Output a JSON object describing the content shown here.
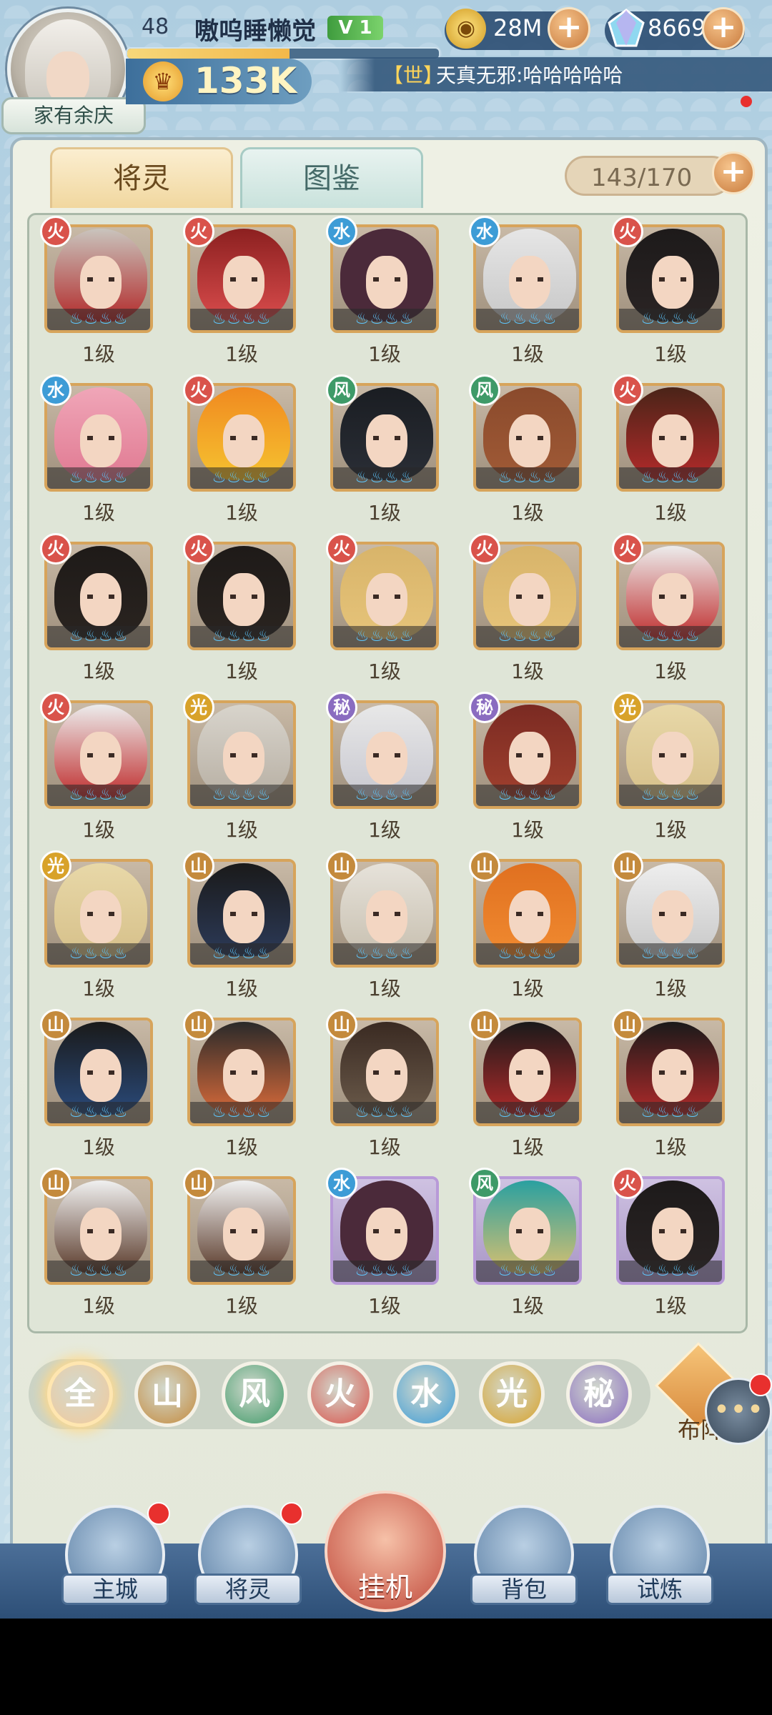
{
  "header": {
    "avatar_icon": "hero-avatar-icon",
    "nickname_badge": "家有余庆",
    "level": "48",
    "player_name": "嗷呜睡懒觉",
    "vip": "V 1",
    "exp_fraction": 0.52,
    "power_value": "133K",
    "gold_value": "28M",
    "gem_value": "8669",
    "plus": "+",
    "chat_channel": "【世】",
    "chat_text": "天真无邪:哈哈哈哈哈"
  },
  "tabs": {
    "spirits": "将灵",
    "codex": "图鉴"
  },
  "capacity": "143/170",
  "grid": {
    "level_label": "1级",
    "stars": "♨♨♨♨",
    "element_colors": {
      "fire": "#d9534b",
      "water": "#3d9cd6",
      "wind": "#3e9a68",
      "light": "#d8a22a",
      "arcane": "#8a6cc0",
      "earth": "#c48a3c"
    },
    "element_glyphs": {
      "fire": "火",
      "water": "水",
      "wind": "风",
      "light": "光",
      "arcane": "秘",
      "earth": "山"
    },
    "cards": [
      {
        "element": "fire",
        "hair": "#c9c4bd",
        "accent": "#b22a2a",
        "rarity": "gold"
      },
      {
        "element": "fire",
        "hair": "#8c2020",
        "accent": "#d94c4c",
        "rarity": "gold"
      },
      {
        "element": "water",
        "hair": "#4b2a3a",
        "accent": "#4b2a3a",
        "rarity": "gold"
      },
      {
        "element": "water",
        "hair": "#e6e6e6",
        "accent": "#c8c8c8",
        "rarity": "gold"
      },
      {
        "element": "fire",
        "hair": "#1d1a1a",
        "accent": "#2a2424",
        "rarity": "gold"
      },
      {
        "element": "water",
        "hair": "#f0a6b8",
        "accent": "#e07a92",
        "rarity": "gold"
      },
      {
        "element": "fire",
        "hair": "#f08a20",
        "accent": "#f6c230",
        "rarity": "gold"
      },
      {
        "element": "wind",
        "hair": "#1a1d22",
        "accent": "#2a2e36",
        "rarity": "gold"
      },
      {
        "element": "wind",
        "hair": "#8a4a2c",
        "accent": "#a05a36",
        "rarity": "gold"
      },
      {
        "element": "fire",
        "hair": "#4a2418",
        "accent": "#b32a2a",
        "rarity": "gold"
      },
      {
        "element": "fire",
        "hair": "#1e1a18",
        "accent": "#2a2420",
        "rarity": "gold"
      },
      {
        "element": "fire",
        "hair": "#1e1a18",
        "accent": "#2a2420",
        "rarity": "gold"
      },
      {
        "element": "fire",
        "hair": "#d8b46a",
        "accent": "#e6c47a",
        "rarity": "gold"
      },
      {
        "element": "fire",
        "hair": "#d8b46a",
        "accent": "#e6c47a",
        "rarity": "gold"
      },
      {
        "element": "fire",
        "hair": "#ececec",
        "accent": "#c03030",
        "rarity": "gold"
      },
      {
        "element": "fire",
        "hair": "#ececec",
        "accent": "#c03030",
        "rarity": "gold"
      },
      {
        "element": "light",
        "hair": "#d8d4cc",
        "accent": "#b8b0a4",
        "rarity": "gold"
      },
      {
        "element": "arcane",
        "hair": "#e8e8e8",
        "accent": "#c8c8d0",
        "rarity": "gold"
      },
      {
        "element": "arcane",
        "hair": "#7a2a22",
        "accent": "#a0402e",
        "rarity": "gold"
      },
      {
        "element": "light",
        "hair": "#e8d8a8",
        "accent": "#d6c08a",
        "rarity": "gold"
      },
      {
        "element": "light",
        "hair": "#e8d8a8",
        "accent": "#d6c08a",
        "rarity": "gold"
      },
      {
        "element": "earth",
        "hair": "#1a1a1a",
        "accent": "#2c3a58",
        "rarity": "gold"
      },
      {
        "element": "earth",
        "hair": "#e6e2da",
        "accent": "#c8c0b0",
        "rarity": "gold"
      },
      {
        "element": "earth",
        "hair": "#e07020",
        "accent": "#f08a30",
        "rarity": "gold"
      },
      {
        "element": "earth",
        "hair": "#eeeeee",
        "accent": "#c8c8c8",
        "rarity": "gold"
      },
      {
        "element": "earth",
        "hair": "#1a1a1a",
        "accent": "#2a4a7a",
        "rarity": "gold"
      },
      {
        "element": "earth",
        "hair": "#2a2a2a",
        "accent": "#d86a3a",
        "rarity": "gold"
      },
      {
        "element": "earth",
        "hair": "#3a2a22",
        "accent": "#6a5a4a",
        "rarity": "gold"
      },
      {
        "element": "earth",
        "hair": "#1a1a1a",
        "accent": "#b02a2a",
        "rarity": "gold"
      },
      {
        "element": "earth",
        "hair": "#1a1a1a",
        "accent": "#b02a2a",
        "rarity": "gold"
      },
      {
        "element": "earth",
        "hair": "#f0f0f0",
        "accent": "#5a3a2a",
        "rarity": "gold"
      },
      {
        "element": "earth",
        "hair": "#f0f0f0",
        "accent": "#5a3a2a",
        "rarity": "gold"
      },
      {
        "element": "water",
        "hair": "#4b2a3a",
        "accent": "#4b2a3a",
        "rarity": "purple"
      },
      {
        "element": "wind",
        "hair": "#2aa0a0",
        "accent": "#d8c070",
        "rarity": "purple"
      },
      {
        "element": "fire",
        "hair": "#1d1a1a",
        "accent": "#2a2424",
        "rarity": "purple"
      }
    ]
  },
  "filters": [
    {
      "key": "all",
      "label": "全",
      "color": "#f2c99a",
      "selected": true
    },
    {
      "key": "earth",
      "label": "山",
      "color": "#c48a3c"
    },
    {
      "key": "wind",
      "label": "风",
      "color": "#3e9a68"
    },
    {
      "key": "fire",
      "label": "火",
      "color": "#d9534b"
    },
    {
      "key": "water",
      "label": "水",
      "color": "#3d9cd6"
    },
    {
      "key": "light",
      "label": "光",
      "color": "#d8a22a"
    },
    {
      "key": "arcane",
      "label": "秘",
      "color": "#8a6cc0"
    }
  ],
  "layout_button": "布阵",
  "chat_icon": "chat-bubble-icon",
  "nav": [
    {
      "key": "main-city",
      "label": "主城",
      "dot": true
    },
    {
      "key": "spirits",
      "label": "将灵",
      "dot": true
    },
    {
      "key": "idle",
      "label": "挂机",
      "dot": false
    },
    {
      "key": "bag",
      "label": "背包",
      "dot": false
    },
    {
      "key": "trial",
      "label": "试炼",
      "dot": false
    }
  ]
}
